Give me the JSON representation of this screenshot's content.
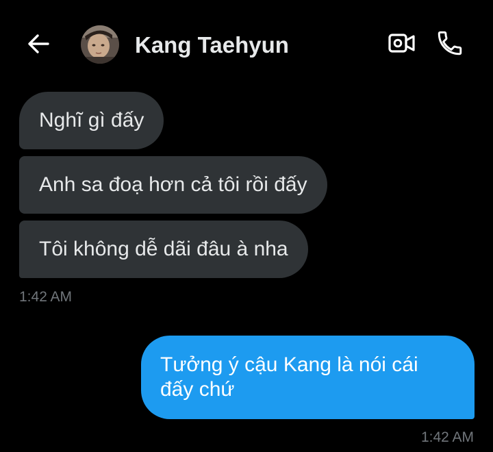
{
  "header": {
    "contact_name": "Kang Taehyun",
    "back_icon": "arrow-left-icon",
    "video_icon": "video-camera-icon",
    "call_icon": "phone-icon"
  },
  "messages": [
    {
      "direction": "received",
      "text": "Nghĩ gì đấy"
    },
    {
      "direction": "received",
      "text": "Anh sa đoạ hơn cả tôi rồi đấy"
    },
    {
      "direction": "received",
      "text": "Tôi không dễ dãi đâu à nha"
    },
    {
      "direction": "sent",
      "text": "Tưởng ý cậu Kang là nói cái đấy chứ"
    }
  ],
  "timestamps": {
    "received_group": "1:42 AM",
    "sent_group": "1:42 AM"
  },
  "colors": {
    "background": "#000000",
    "received_bubble": "#2f3336",
    "sent_bubble": "#1d9bf0",
    "primary_text": "#e7e9ea",
    "secondary_text": "#71767b"
  }
}
